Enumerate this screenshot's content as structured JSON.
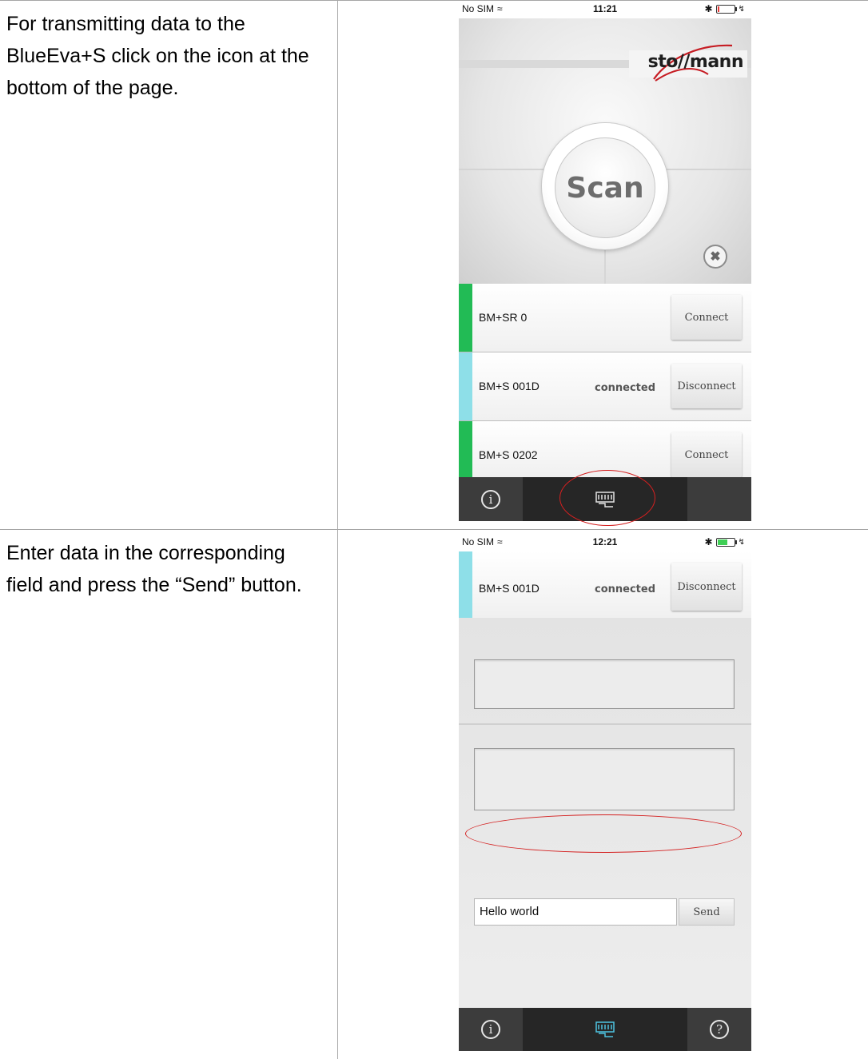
{
  "instructions": [
    "For transmitting data to the BlueEva+S click on the icon at the bottom of the page.",
    "Enter data in the corresponding field and press the “Send” button."
  ],
  "screen1": {
    "status": {
      "carrier": "No SIM",
      "time": "11:21",
      "battery_color": "#e53935",
      "battery_level": 0.1
    },
    "logo": "sto//mann",
    "scan_label": "Scan",
    "devices": [
      {
        "name": "BM+SR 0",
        "status": "",
        "button": "Connect",
        "color": "#22bb55"
      },
      {
        "name": "BM+S 001D",
        "status": "connected",
        "button": "Disconnect",
        "color": "#8edfe8"
      },
      {
        "name": "BM+S 0202",
        "status": "",
        "button": "Connect",
        "color": "#22bb55"
      }
    ],
    "tabs": [
      "info-icon",
      "terminal-icon"
    ]
  },
  "screen2": {
    "status": {
      "carrier": "No SIM",
      "time": "12:21",
      "battery_color": "#3fcf55",
      "battery_level": 0.6
    },
    "device": {
      "name": "BM+S 001D",
      "status": "connected",
      "button": "Disconnect",
      "color": "#8edfe8"
    },
    "input_value": "Hello world",
    "send_label": "Send",
    "tabs": [
      "info-icon",
      "terminal-icon",
      "help-icon"
    ]
  },
  "colors": {
    "highlight": "#d42020",
    "tab_bg": "#3c3c3c",
    "terminal_active": "#4fc3e0"
  }
}
